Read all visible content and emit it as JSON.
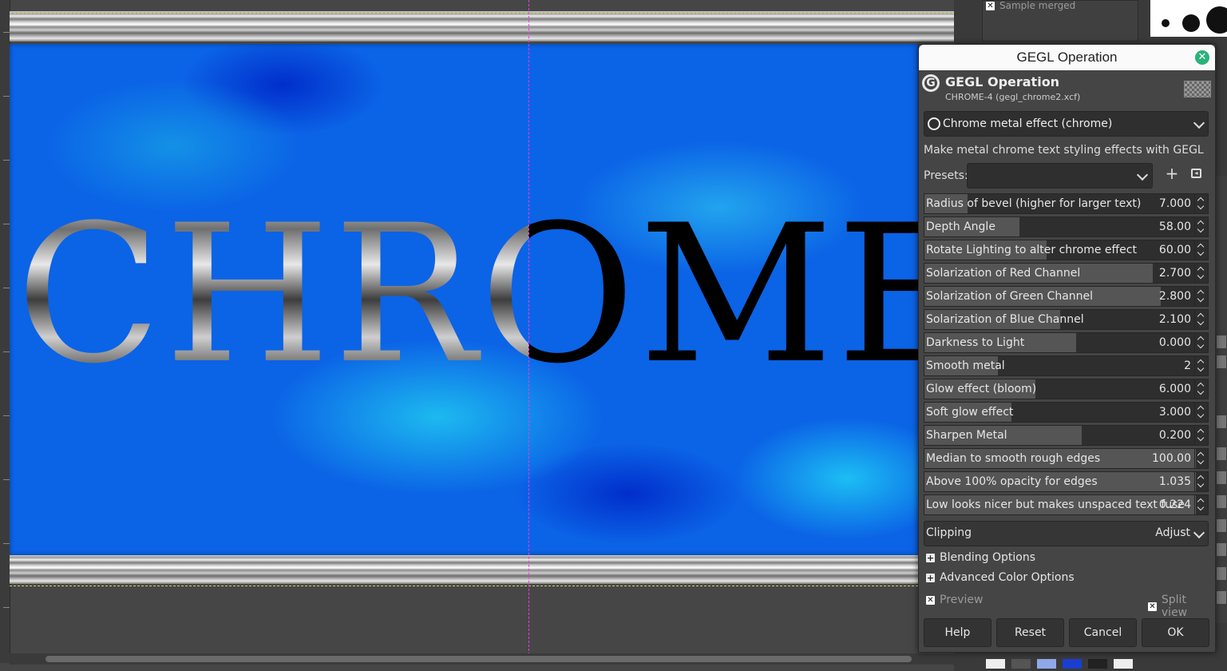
{
  "canvas": {
    "chrome_word_left": "CHRO",
    "chrome_word_full": "CHROME",
    "colors": {
      "background_blue": "#0b63e6",
      "guide": "#e040e0"
    }
  },
  "dock": {
    "sample_merged_label": "Sample merged"
  },
  "dialog": {
    "window_title": "GEGL Operation",
    "header_title": "GEGL Operation",
    "header_subtitle": "CHROME-4 (gegl_chrome2.xcf)",
    "operation": "Chrome metal effect (chrome)",
    "description": "Make metal chrome text styling effects with GEGL",
    "presets_label": "Presets:",
    "presets_value": "",
    "params": [
      {
        "label": "Radius of bevel (higher for larger text)",
        "value": "7.000",
        "fraction": 0.16
      },
      {
        "label": "Depth Angle",
        "value": "58.00",
        "fraction": 0.35
      },
      {
        "label": "Rotate Lighting to alter chrome effect",
        "value": "60.00",
        "fraction": 0.45
      },
      {
        "label": "Solarization of Red Channel",
        "value": "2.700",
        "fraction": 0.84
      },
      {
        "label": "Solarization of Green Channel",
        "value": "2.800",
        "fraction": 0.87
      },
      {
        "label": "Solarization of Blue Channel",
        "value": "2.100",
        "fraction": 0.5
      },
      {
        "label": "Darkness to Light",
        "value": "0.000",
        "fraction": 0.56
      },
      {
        "label": "Smooth metal",
        "value": "2",
        "fraction": 0.27
      },
      {
        "label": "Glow effect (bloom)",
        "value": "6.000",
        "fraction": 0.41
      },
      {
        "label": "Soft glow effect",
        "value": "3.000",
        "fraction": 0.32
      },
      {
        "label": "Sharpen Metal",
        "value": "0.200",
        "fraction": 0.58
      },
      {
        "label": "Median to smooth rough edges",
        "value": "100.00",
        "fraction": 1.0
      },
      {
        "label": "Above 100% opacity for edges",
        "value": "1.035",
        "fraction": 1.0
      },
      {
        "label": "Low looks nicer but makes unspaced text fuse",
        "value": "0.224",
        "fraction": 1.0
      }
    ],
    "clipping_label": "Clipping",
    "clipping_value": "Adjust",
    "blending_options": "Blending Options",
    "advanced_color_options": "Advanced Color Options",
    "preview_label": "Preview",
    "split_view_label": "Split view",
    "buttons": {
      "help": "Help",
      "reset": "Reset",
      "cancel": "Cancel",
      "ok": "OK"
    }
  }
}
